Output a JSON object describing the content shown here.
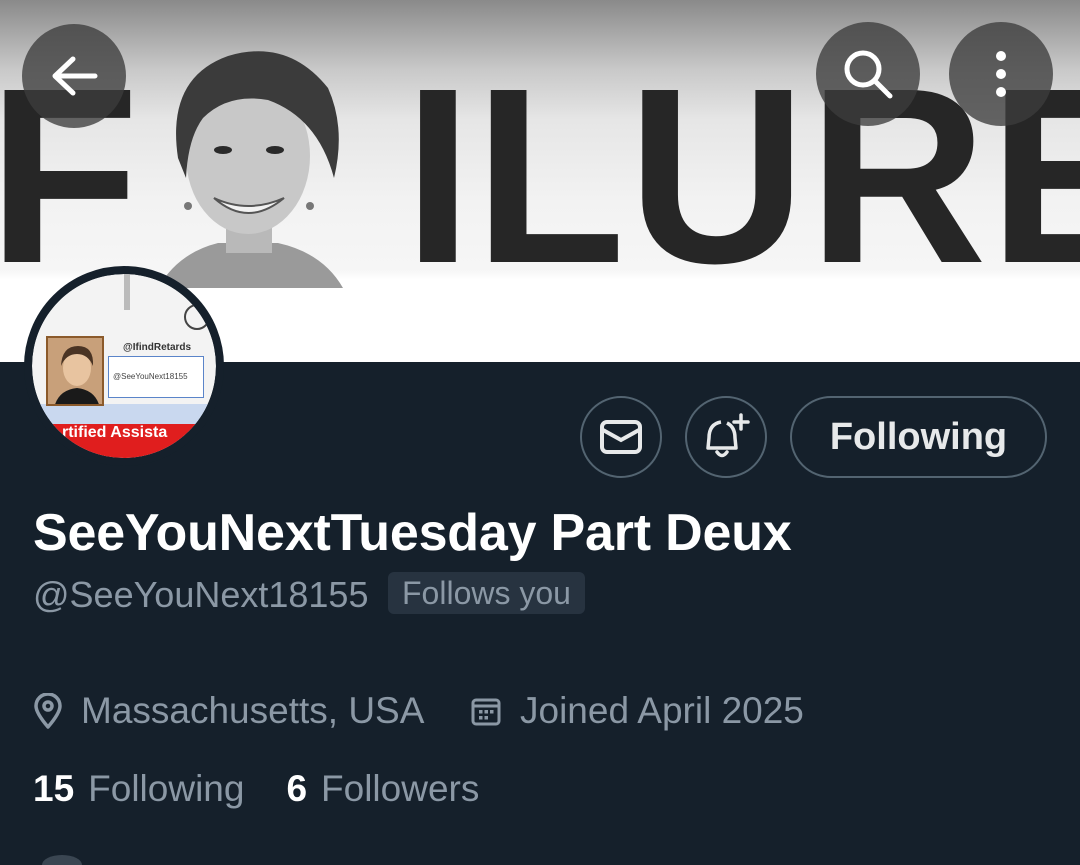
{
  "banner": {
    "text_before": "F",
    "text_after": "ILURE"
  },
  "top_bar": {
    "back_icon": "arrow-left-icon",
    "search_icon": "search-icon",
    "more_icon": "more-vertical-icon"
  },
  "avatar": {
    "handle_text": "@IfindRetards",
    "card_text": "@SeeYouNext18155",
    "banner_text": "rtified Assista"
  },
  "actions": {
    "message_icon": "envelope-icon",
    "notify_icon": "bell-plus-icon",
    "following_label": "Following"
  },
  "profile": {
    "display_name": "SeeYouNextTuesday Part Deux",
    "handle": "@SeeYouNext18155",
    "follows_you": "Follows you",
    "location": "Massachusetts, USA",
    "joined": "Joined April 2025",
    "following_count": "15",
    "following_label": "Following",
    "followers_count": "6",
    "followers_label": "Followers"
  },
  "colors": {
    "background": "#15202b",
    "secondary_text": "#8b98a5",
    "border": "#536471",
    "primary_text": "#e7e9ea"
  }
}
